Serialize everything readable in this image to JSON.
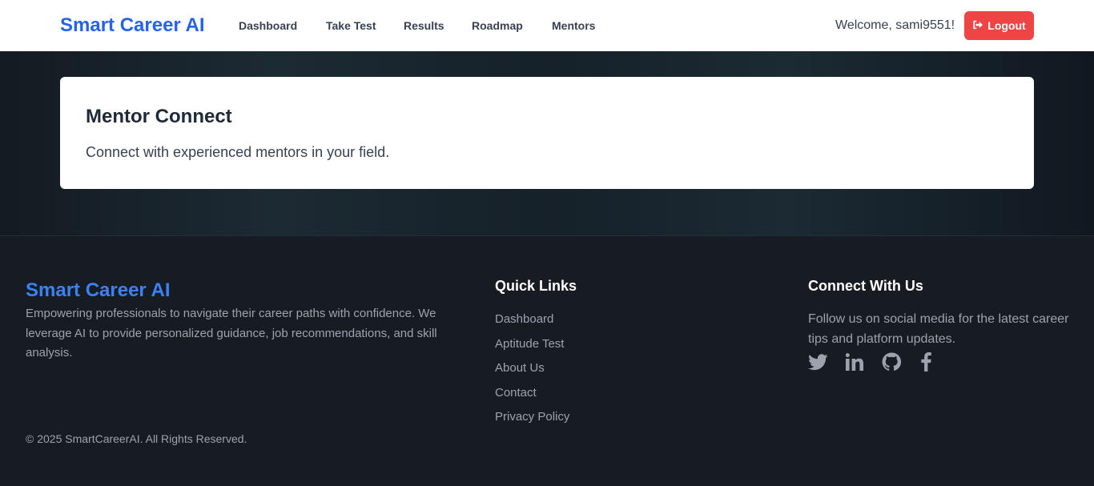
{
  "nav": {
    "brand": "Smart Career AI",
    "links": [
      "Dashboard",
      "Take Test",
      "Results",
      "Roadmap",
      "Mentors"
    ],
    "welcome": "Welcome, sami9551!",
    "logout_label": "Logout"
  },
  "main": {
    "card": {
      "title": "Mentor Connect",
      "subtitle": "Connect with experienced mentors in your field."
    }
  },
  "footer": {
    "brand": "Smart Career AI",
    "description": "Empowering professionals to navigate their career paths with confidence. We leverage AI to provide personalized guidance, job recommendations, and skill analysis.",
    "copyright": "© 2025 SmartCareerAI. All Rights Reserved.",
    "quick_links": {
      "title": "Quick Links",
      "items": [
        "Dashboard",
        "Aptitude Test",
        "About Us",
        "Contact",
        "Privacy Policy"
      ]
    },
    "connect": {
      "title": "Connect With Us",
      "text": "Follow us on social media for the latest career tips and platform updates.",
      "icons": [
        "twitter-icon",
        "linkedin-icon",
        "github-icon",
        "facebook-icon"
      ]
    }
  },
  "colors": {
    "brand_blue": "#2563eb",
    "logout_red": "#ef4444",
    "footer_bg": "#171b22"
  }
}
